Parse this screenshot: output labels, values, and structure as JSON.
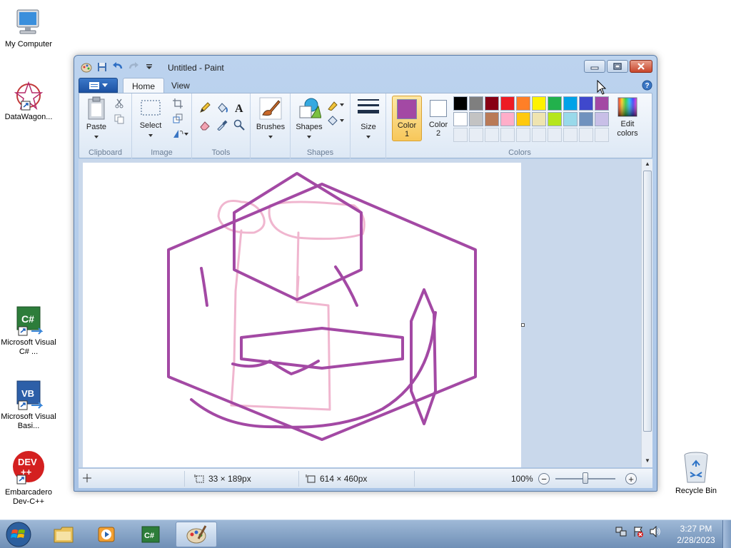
{
  "desktop": {
    "icons": [
      {
        "label": "My Computer"
      },
      {
        "label": "DataWagon..."
      },
      {
        "label": "Microsoft Visual C# ..."
      },
      {
        "label": "Microsoft Visual Basi..."
      },
      {
        "label": "Embarcadero Dev-C++"
      },
      {
        "label": "Recycle Bin"
      }
    ]
  },
  "window": {
    "title": "Untitled - Paint",
    "tabs": [
      "Home",
      "View"
    ],
    "ribbon": {
      "clipboard": {
        "label": "Clipboard",
        "paste": "Paste"
      },
      "image": {
        "label": "Image",
        "select": "Select"
      },
      "tools": {
        "label": "Tools"
      },
      "brushes": {
        "label": "Brushes"
      },
      "shapes": {
        "label": "Shapes",
        "shapes_btn": "Shapes"
      },
      "size": {
        "label": "Size"
      },
      "colors": {
        "label": "Colors",
        "color1_line1": "Color",
        "color1_line2": "1",
        "color2_line1": "Color",
        "color2_line2": "2",
        "edit_line1": "Edit",
        "edit_line2": "colors",
        "color1_value": "#a349a4",
        "color2_value": "#ffffff",
        "palette_row1": [
          "#000000",
          "#7f7f7f",
          "#880015",
          "#ed1c24",
          "#ff7f27",
          "#fff200",
          "#22b14c",
          "#00a2e8",
          "#3f48cc",
          "#a349a4"
        ],
        "palette_row2": [
          "#ffffff",
          "#c3c3c3",
          "#b97a57",
          "#ffaec9",
          "#ffc90e",
          "#efe4b0",
          "#b5e61d",
          "#99d9ea",
          "#7092be",
          "#c8bfe7"
        ]
      }
    },
    "statusbar": {
      "selection_size": "33 × 189px",
      "canvas_size": "614 × 460px",
      "zoom": "100%"
    }
  },
  "drawing": {
    "stroke_purple": "#a349a4",
    "stroke_pink": "#f0b6cf"
  },
  "taskbar": {
    "time": "3:27 PM",
    "date": "2/28/2023"
  }
}
